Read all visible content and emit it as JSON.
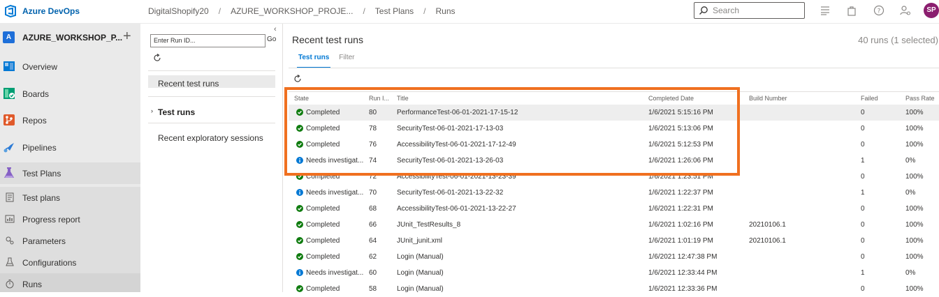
{
  "header": {
    "brand": "Azure DevOps",
    "breadcrumbs": [
      "DigitalShopify20",
      "AZURE_WORKSHOP_PROJE...",
      "Test Plans",
      "Runs"
    ],
    "search_placeholder": "Search",
    "avatar_initials": "SP"
  },
  "project": {
    "initial": "A",
    "name": "AZURE_WORKSHOP_P...",
    "add_symbol": "+"
  },
  "nav": {
    "items": [
      {
        "label": "Overview",
        "icon": "overview-icon"
      },
      {
        "label": "Boards",
        "icon": "boards-icon"
      },
      {
        "label": "Repos",
        "icon": "repos-icon"
      },
      {
        "label": "Pipelines",
        "icon": "pipelines-icon"
      },
      {
        "label": "Test Plans",
        "icon": "test-plans-icon"
      }
    ],
    "sub_items": [
      {
        "label": "Test plans",
        "icon": "test-plans-list-icon"
      },
      {
        "label": "Progress report",
        "icon": "progress-report-icon"
      },
      {
        "label": "Parameters",
        "icon": "parameters-icon"
      },
      {
        "label": "Configurations",
        "icon": "configurations-icon"
      },
      {
        "label": "Runs",
        "icon": "runs-icon"
      }
    ]
  },
  "mid": {
    "collapse_symbol": "‹",
    "run_id_placeholder": "Enter Run ID...",
    "go_label": "Go",
    "recent_runs": "Recent test runs",
    "chevron": "›",
    "test_runs": "Test runs",
    "recent_exploratory": "Recent exploratory sessions"
  },
  "main": {
    "title": "Recent test runs",
    "count": "40 runs (1 selected)",
    "tabs": [
      "Test runs",
      "Filter"
    ],
    "columns": {
      "state": "State",
      "run_id": "Run I...",
      "title": "Title",
      "completed_date": "Completed Date",
      "build_number": "Build Number",
      "failed": "Failed",
      "pass_rate": "Pass Rate"
    },
    "colors": {
      "completed": "#107c10",
      "needs_investigation": "#0078d4",
      "highlight": "#f07020"
    },
    "rows": [
      {
        "state": "Completed",
        "status": "completed",
        "run_id": "80",
        "title": "PerformanceTest-06-01-2021-17-15-12",
        "date": "1/6/2021 5:15:16 PM",
        "build": "",
        "failed": "0",
        "pass_rate": "100%"
      },
      {
        "state": "Completed",
        "status": "completed",
        "run_id": "78",
        "title": "SecurityTest-06-01-2021-17-13-03",
        "date": "1/6/2021 5:13:06 PM",
        "build": "",
        "failed": "0",
        "pass_rate": "100%"
      },
      {
        "state": "Completed",
        "status": "completed",
        "run_id": "76",
        "title": "AccessibilityTest-06-01-2021-17-12-49",
        "date": "1/6/2021 5:12:53 PM",
        "build": "",
        "failed": "0",
        "pass_rate": "100%"
      },
      {
        "state": "Needs investigat...",
        "status": "needs",
        "run_id": "74",
        "title": "SecurityTest-06-01-2021-13-26-03",
        "date": "1/6/2021 1:26:06 PM",
        "build": "",
        "failed": "1",
        "pass_rate": "0%"
      },
      {
        "state": "Completed",
        "status": "completed",
        "run_id": "72",
        "title": "AccessibilityTest-06-01-2021-13-23-39",
        "date": "1/6/2021 1:23:51 PM",
        "build": "",
        "failed": "0",
        "pass_rate": "100%"
      },
      {
        "state": "Needs investigat...",
        "status": "needs",
        "run_id": "70",
        "title": "SecurityTest-06-01-2021-13-22-32",
        "date": "1/6/2021 1:22:37 PM",
        "build": "",
        "failed": "1",
        "pass_rate": "0%"
      },
      {
        "state": "Completed",
        "status": "completed",
        "run_id": "68",
        "title": "AccessibilityTest-06-01-2021-13-22-27",
        "date": "1/6/2021 1:22:31 PM",
        "build": "",
        "failed": "0",
        "pass_rate": "100%"
      },
      {
        "state": "Completed",
        "status": "completed",
        "run_id": "66",
        "title": "JUnit_TestResults_8",
        "date": "1/6/2021 1:02:16 PM",
        "build": "20210106.1",
        "failed": "0",
        "pass_rate": "100%"
      },
      {
        "state": "Completed",
        "status": "completed",
        "run_id": "64",
        "title": "JUnit_junit.xml",
        "date": "1/6/2021 1:01:19 PM",
        "build": "20210106.1",
        "failed": "0",
        "pass_rate": "100%"
      },
      {
        "state": "Completed",
        "status": "completed",
        "run_id": "62",
        "title": "Login (Manual)",
        "date": "1/6/2021 12:47:38 PM",
        "build": "",
        "failed": "0",
        "pass_rate": "100%"
      },
      {
        "state": "Needs investigat...",
        "status": "needs",
        "run_id": "60",
        "title": "Login (Manual)",
        "date": "1/6/2021 12:33:44 PM",
        "build": "",
        "failed": "1",
        "pass_rate": "0%"
      },
      {
        "state": "Completed",
        "status": "completed",
        "run_id": "58",
        "title": "Login (Manual)",
        "date": "1/6/2021 12:33:36 PM",
        "build": "",
        "failed": "0",
        "pass_rate": "100%"
      }
    ]
  }
}
